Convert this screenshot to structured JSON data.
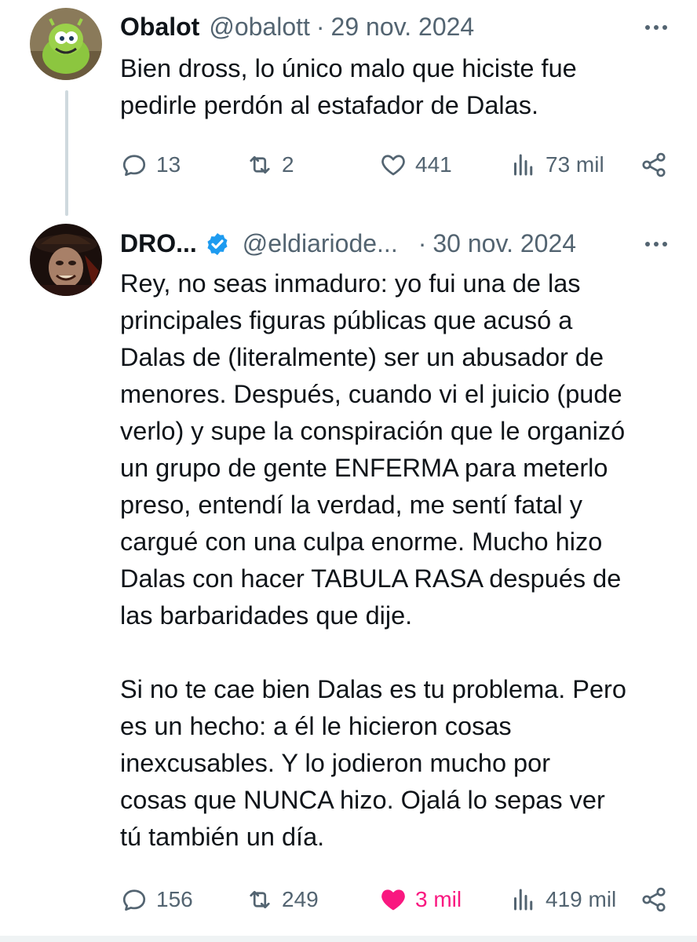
{
  "tweet1": {
    "name": "Obalot",
    "handle": "@obalott",
    "separator": "·",
    "date": "29 nov. 2024",
    "text": "Bien dross, lo único malo que hiciste fue\npedirle perdón al estafador de Dalas.",
    "replies": "13",
    "retweets": "2",
    "likes": "441",
    "views": "73 mil"
  },
  "tweet2": {
    "name": "DRO...",
    "handle": "@eldiariode...",
    "separator": "·",
    "date": "30 nov. 2024",
    "verified": true,
    "text": "Rey, no seas inmaduro: yo fui una de las\nprincipales figuras públicas que acusó a\nDalas de (literalmente) ser un abusador de\nmenores. Después, cuando vi el juicio (pude\nverlo) y supe la conspiración que le organizó\nun grupo de gente ENFERMA para meterlo\npreso, entendí la verdad, me sentí fatal y\ncargué con una culpa enorme. Mucho hizo\nDalas con hacer TABULA RASA después de\nlas barbaridades que dije.\n\nSi no te cae bien Dalas es tu problema. Pero\nes un hecho: a él le hicieron cosas\ninexcusables. Y lo jodieron mucho por\ncosas que NUNCA hizo. Ojalá lo sepas ver\ntú también un día.",
    "replies": "156",
    "retweets": "249",
    "likes": "3 mil",
    "views": "419 mil",
    "liked": true
  },
  "colors": {
    "text": "#0f1419",
    "secondary": "#536471",
    "like_active": "#f91880",
    "verified": "#1d9bf0",
    "thread_line": "#cfd9de"
  },
  "icons": [
    "reply-icon",
    "retweet-icon",
    "like-icon",
    "views-icon",
    "share-icon",
    "more-icon",
    "verified-badge-icon"
  ]
}
